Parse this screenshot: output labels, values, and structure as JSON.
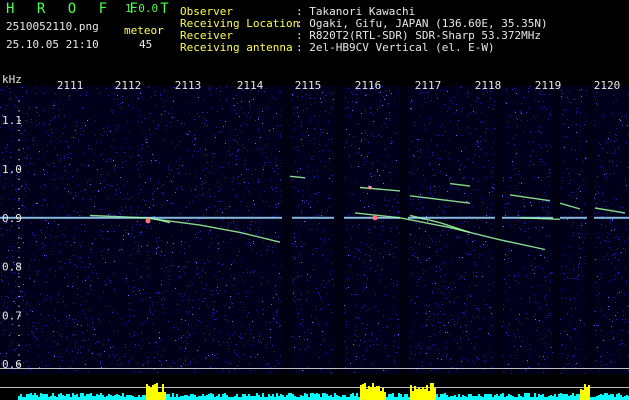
{
  "app": {
    "name": "H R O F F T",
    "version": "1.0.0",
    "filename": "2510052110.png",
    "datetime": "25.10.05 21:10",
    "meteor_label": "meteor",
    "meteor_count": "45"
  },
  "info": [
    {
      "label": "Observer",
      "value": ": Takanori Kawachi"
    },
    {
      "label": "Receiving Location",
      "value": ": Ogaki, Gifu, JAPAN (136.60E, 35.35N)"
    },
    {
      "label": "Receiver",
      "value": ": R820T2(RTL-SDR) SDR-Sharp 53.372MHz"
    },
    {
      "label": "Receiving antenna",
      "value": ": 2el-HB9CV Vertical (el. E-W)"
    }
  ],
  "axis": {
    "unit": "kHz",
    "y_ticks": [
      "1.1",
      "1.0",
      "0.9",
      "0.8",
      "0.7",
      "0.6"
    ],
    "x_ticks": [
      "2111",
      "2112",
      "2113",
      "2114",
      "2115",
      "2116",
      "2117",
      "2118",
      "2119",
      "2120"
    ]
  },
  "chart_data": {
    "type": "heatmap",
    "y_unit": "kHz",
    "y_range": [
      0.58,
      1.17
    ],
    "x_range_minutes": [
      "2111",
      "2120"
    ],
    "carrier_khz": 0.9,
    "gaps_at": [
      "2115",
      "2116",
      "2117",
      "2119",
      "2120"
    ],
    "colors": {
      "background": "#00001a",
      "noise_1": "#1a1ab0",
      "noise_2": "#3c64ff",
      "carrier": "#9ad8ff",
      "meteor": "#9fff9f",
      "power_high": "#ffff00",
      "power_low": "#00ffff"
    }
  }
}
